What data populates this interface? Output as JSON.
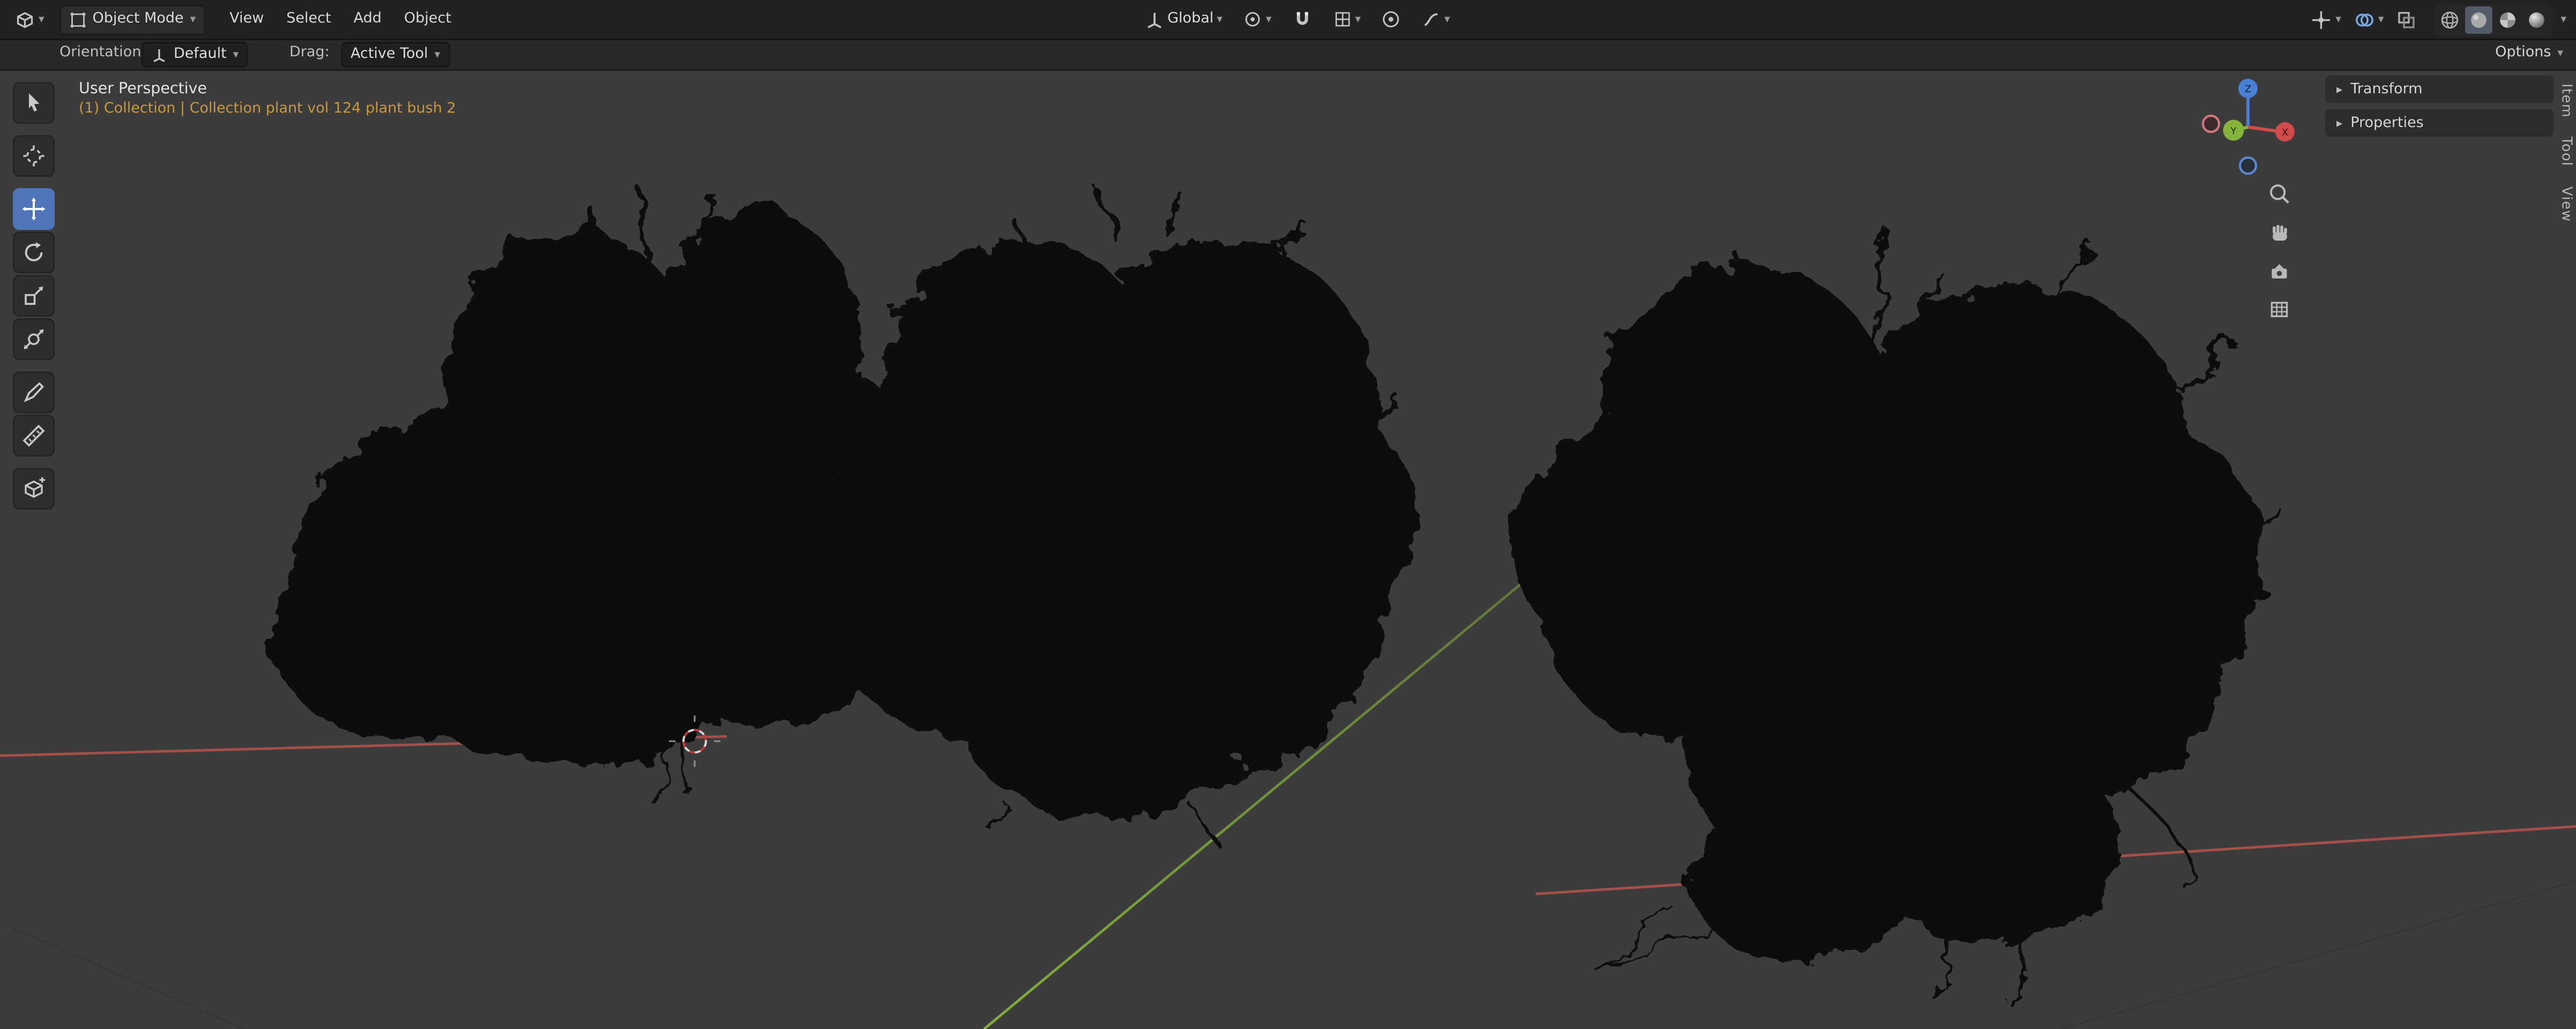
{
  "topbar": {
    "editor_selector": {
      "icon": "editor-type-icon"
    },
    "mode": {
      "icon": "object-mode-icon",
      "label": "Object Mode"
    },
    "menus": [
      "View",
      "Select",
      "Add",
      "Object"
    ],
    "transform_orientation": {
      "icon": "orientation-axes-icon",
      "label": "Global"
    },
    "pivot": {
      "icon": "pivot-point-icon"
    },
    "snap": {
      "icon": "snap-magnet-icon",
      "settings_icon": "snap-settings-icon"
    },
    "proportional": {
      "icon": "proportional-editing-icon",
      "falloff_icon": "falloff-curve-icon"
    },
    "right_icons": {
      "gizmos": "show-gizmos-icon",
      "overlays": "show-overlays-icon",
      "xray": "toggle-xray-icon",
      "shading": [
        "wireframe-shading-icon",
        "solid-shading-icon",
        "material-shading-icon",
        "rendered-shading-icon"
      ],
      "active_shading": "solid"
    }
  },
  "tool_settings": {
    "orientation_label": "Orientation:",
    "orientation_value": "Default",
    "drag_label": "Drag:",
    "drag_value": "Active Tool",
    "options_label": "Options"
  },
  "toolbar": {
    "tools": [
      {
        "icon": "select-box-icon"
      },
      {
        "icon": "cursor-3d-icon"
      },
      {
        "icon": "move-icon",
        "active": true
      },
      {
        "icon": "rotate-icon"
      },
      {
        "icon": "scale-icon"
      },
      {
        "icon": "transform-icon"
      },
      {
        "icon": "annotate-icon"
      },
      {
        "icon": "measure-icon"
      },
      {
        "icon": "add-cube-icon"
      }
    ]
  },
  "viewport": {
    "view_label": "User Perspective",
    "collection_path": "(1) Collection | Collection plant vol 124 plant bush 2",
    "gizmo": {
      "x": "X",
      "y": "Y",
      "z": "Z"
    },
    "nav_icons": [
      "zoom-icon",
      "pan-hand-icon",
      "camera-view-icon",
      "toggle-ortho-icon"
    ],
    "objects": [
      "plant-bush-1",
      "plant-bush-2",
      "plant-bush-3"
    ]
  },
  "sidebar": {
    "sections": [
      {
        "label": "Transform"
      },
      {
        "label": "Properties"
      }
    ],
    "tabs": [
      {
        "label": "Item"
      },
      {
        "label": "Tool"
      },
      {
        "label": "View"
      }
    ]
  },
  "colors": {
    "accent_blue": "#4f74b8",
    "axis_x_red": "#b5524b",
    "axis_y_green": "#86b33c",
    "axis_z_blue": "#4a7fd6",
    "highlight_orange": "#c9983f"
  }
}
